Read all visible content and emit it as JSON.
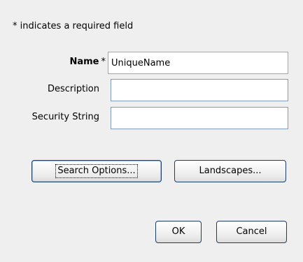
{
  "dialog": {
    "required_note": "* indicates a required field",
    "fields": {
      "name": {
        "label": "Name",
        "required_marker": "*",
        "value": "UniqueName"
      },
      "description": {
        "label": "Description",
        "value": ""
      },
      "security_string": {
        "label": "Security String",
        "value": ""
      }
    },
    "buttons": {
      "search_options": "Search Options...",
      "landscapes": "Landscapes...",
      "ok": "OK",
      "cancel": "Cancel"
    }
  },
  "colors": {
    "dialog_background": "#efefef",
    "field_border": "#7f9db9",
    "button_border": "#1c3c6e"
  }
}
